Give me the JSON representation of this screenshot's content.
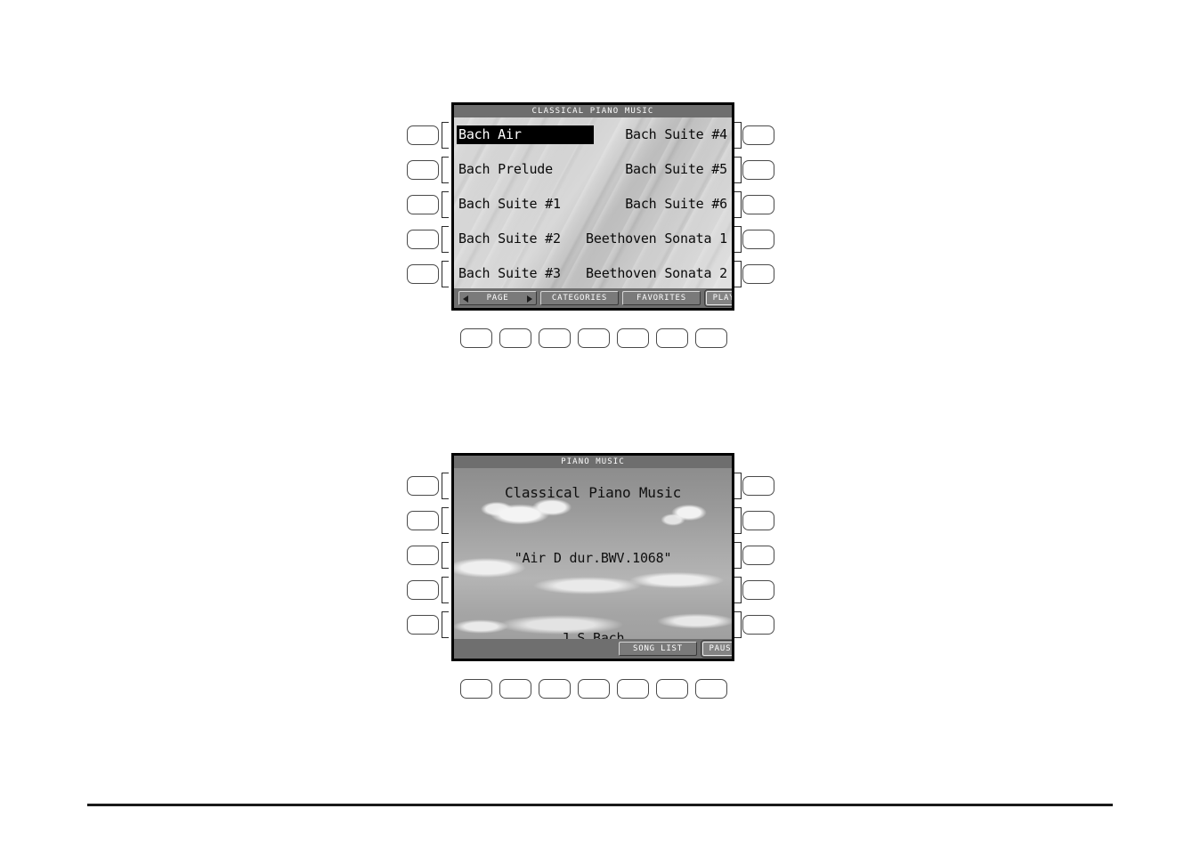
{
  "page": {
    "figures": [
      {
        "id": "song-list-screen",
        "title": "CLASSICAL PIANO MUSIC",
        "background": "sheet-music-photo",
        "rows": [
          {
            "left": "Bach Air",
            "right": "Bach Suite #4",
            "left_selected": true
          },
          {
            "left": "Bach Prelude",
            "right": "Bach Suite #5",
            "left_selected": false
          },
          {
            "left": "Bach Suite #1",
            "right": "Bach Suite #6",
            "left_selected": false
          },
          {
            "left": "Bach Suite #2",
            "right": "Beethoven Sonata 1",
            "left_selected": false
          },
          {
            "left": "Bach Suite #3",
            "right": "Beethoven Sonata 2",
            "left_selected": false
          }
        ],
        "softkeys": [
          {
            "label": "PAGE",
            "name": "page-softkey",
            "arrows": true,
            "selected": false
          },
          {
            "label": "CATEGORIES",
            "name": "categories-softkey",
            "arrows": false,
            "selected": false
          },
          {
            "label": "FAVORITES",
            "name": "favorites-softkey",
            "arrows": false,
            "selected": false
          },
          {
            "label": "PLAY",
            "name": "play-softkey",
            "arrows": false,
            "selected": true
          }
        ]
      },
      {
        "id": "now-playing-screen",
        "title": "PIANO MUSIC",
        "background": "clouds-photo",
        "lines": {
          "category": "Classical Piano Music",
          "piece": "\"Air D dur.BWV.1068\"",
          "composer": "J.S.Bach"
        },
        "softkeys": [
          {
            "label": "SONG LIST",
            "name": "song-list-softkey",
            "arrows": false,
            "selected": false
          },
          {
            "label": "PAUSE",
            "name": "pause-softkey",
            "arrows": false,
            "selected": true
          }
        ]
      }
    ],
    "colors": {
      "lcd_titlebar": "#6e6e6e",
      "lcd_softbar": "#6f6f6f",
      "selection_highlight": "#000000",
      "selection_text": "#ffffff",
      "frame_border": "#000000",
      "rule": "#1a1a1a"
    }
  }
}
